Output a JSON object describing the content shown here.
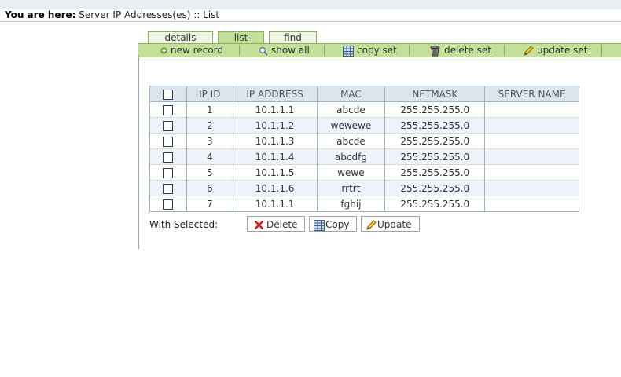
{
  "breadcrumb": {
    "label": "You are here:",
    "path": "Server IP Addresses(es) :: List"
  },
  "tabs": [
    {
      "label": "details",
      "active": false
    },
    {
      "label": "list",
      "active": true
    },
    {
      "label": "find",
      "active": false
    }
  ],
  "toolbar": {
    "new_record": {
      "label": "new record",
      "icon": "green-plus-icon"
    },
    "show_all": {
      "label": "show all",
      "icon": "magnifier-icon"
    },
    "copy_set": {
      "label": "copy set",
      "icon": "copy-table-icon"
    },
    "delete_set": {
      "label": "delete set",
      "icon": "trash-icon"
    },
    "update_set": {
      "label": "update set",
      "icon": "pencil-icon"
    }
  },
  "table": {
    "headers": [
      "IP ID",
      "IP ADDRESS",
      "MAC",
      "NETMASK",
      "SERVER NAME"
    ],
    "rows": [
      {
        "id": "1",
        "ip": "10.1.1.1",
        "mac": "abcde",
        "netmask": "255.255.255.0",
        "server": ""
      },
      {
        "id": "2",
        "ip": "10.1.1.2",
        "mac": "wewewe",
        "netmask": "255.255.255.0",
        "server": ""
      },
      {
        "id": "3",
        "ip": "10.1.1.3",
        "mac": "abcde",
        "netmask": "255.255.255.0",
        "server": ""
      },
      {
        "id": "4",
        "ip": "10.1.1.4",
        "mac": "abcdfg",
        "netmask": "255.255.255.0",
        "server": ""
      },
      {
        "id": "5",
        "ip": "10.1.1.5",
        "mac": "wewe",
        "netmask": "255.255.255.0",
        "server": ""
      },
      {
        "id": "6",
        "ip": "10.1.1.6",
        "mac": "rrtrt",
        "netmask": "255.255.255.0",
        "server": ""
      },
      {
        "id": "7",
        "ip": "10.1.1.1",
        "mac": "fghij",
        "netmask": "255.255.255.0",
        "server": ""
      }
    ]
  },
  "with_selected": {
    "label": "With Selected:",
    "delete": {
      "label": "Delete",
      "icon": "red-x-icon"
    },
    "copy": {
      "label": "Copy",
      "icon": "copy-table-icon"
    },
    "update": {
      "label": "Update",
      "icon": "pencil-icon"
    }
  },
  "colors": {
    "tab_green": "#c4df98",
    "tab_border": "#88b25c",
    "header_bg": "#dbe5ee",
    "row_alt": "#eef3fb"
  }
}
